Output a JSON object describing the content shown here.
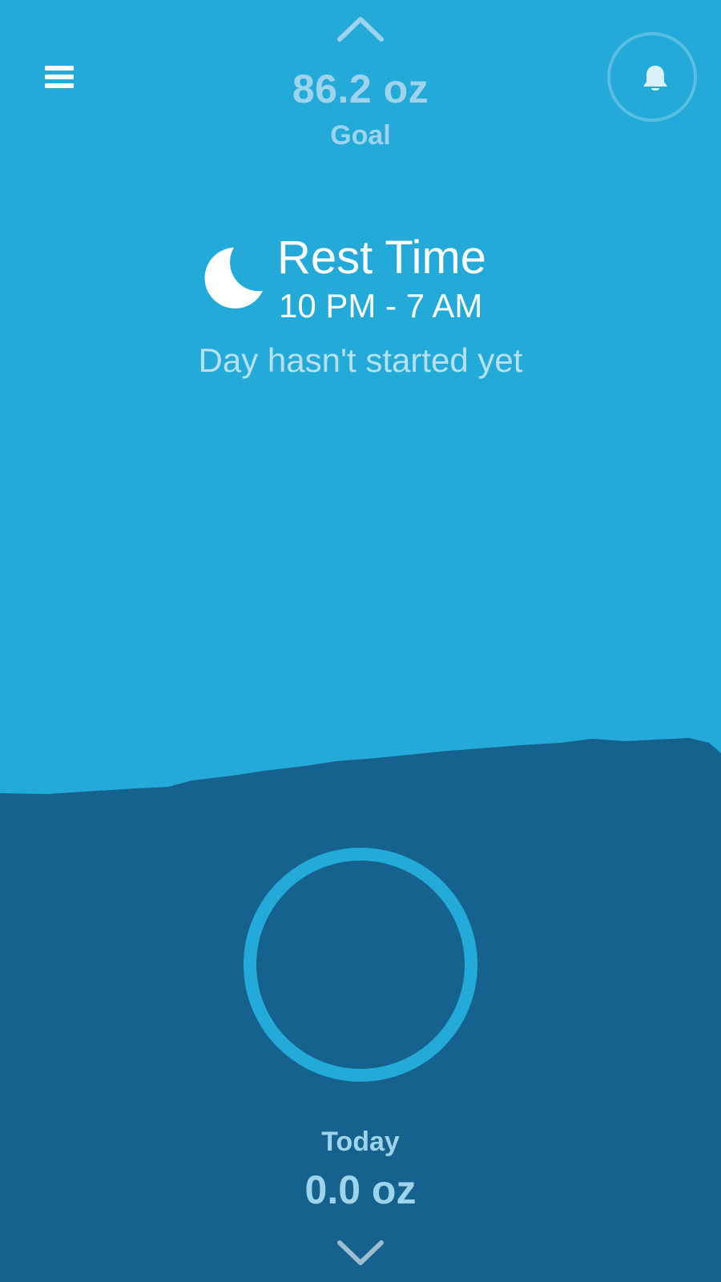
{
  "header": {
    "goal_value": "86.2 oz",
    "goal_label": "Goal",
    "menu_icon": "hamburger-menu-icon",
    "notification_icon": "bell-icon",
    "nav_up_icon": "chevron-up-icon"
  },
  "rest": {
    "icon": "moon-icon",
    "title": "Rest Time",
    "hours": "10 PM - 7 AM",
    "status": "Day hasn't started yet"
  },
  "footer": {
    "today_label": "Today",
    "today_value": "0.0 oz",
    "nav_down_icon": "chevron-down-icon"
  },
  "colors": {
    "sky": "#23AAD9",
    "water": "#15628E",
    "muted_text": "#9ED3EC",
    "white": "#FFFFFF"
  }
}
